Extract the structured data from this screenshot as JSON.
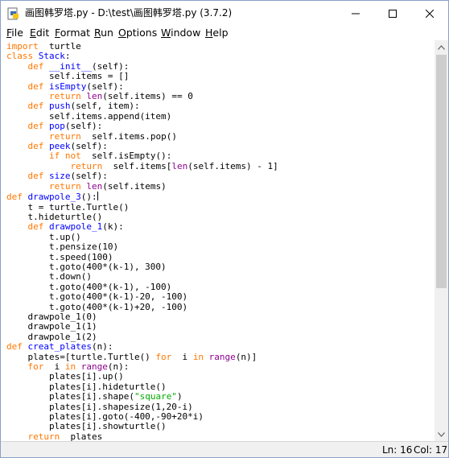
{
  "window": {
    "title": "画图韩罗塔.py - D:\\test\\画图韩罗塔.py (3.7.2)",
    "buttons": [
      "minimize",
      "maximize",
      "close"
    ]
  },
  "menu": [
    {
      "label": "File",
      "u": "F",
      "rest": "ile"
    },
    {
      "label": "Edit",
      "u": "E",
      "rest": "dit"
    },
    {
      "label": "Format",
      "u": "F",
      "rest": "ormat",
      "pre": ""
    },
    {
      "label": "Run",
      "u": "R",
      "rest": "un"
    },
    {
      "label": "Options",
      "u": "O",
      "rest": "ptions"
    },
    {
      "label": "Window",
      "u": "W",
      "rest": "indow"
    },
    {
      "label": "Help",
      "u": "H",
      "rest": "elp"
    }
  ],
  "code_lines": [
    [
      [
        "kw",
        "import"
      ],
      [
        "",
        "  turtle"
      ]
    ],
    [
      [
        "kw",
        "class"
      ],
      [
        "",
        ""
      ],
      [
        "df",
        " Stack"
      ],
      [
        "",
        ":"
      ]
    ],
    [
      [
        "",
        "    "
      ],
      [
        "kw",
        "def"
      ],
      [
        "df",
        " __init__"
      ],
      [
        "",
        "(self):"
      ]
    ],
    [
      [
        "",
        "        self.items = []"
      ]
    ],
    [
      [
        "",
        "    "
      ],
      [
        "kw",
        "def"
      ],
      [
        "df",
        " isEmpty"
      ],
      [
        "",
        "(self):"
      ]
    ],
    [
      [
        "",
        "        "
      ],
      [
        "kw",
        "return"
      ],
      [
        "bi",
        " len"
      ],
      [
        "",
        "(self.items) == 0"
      ]
    ],
    [
      [
        "",
        "    "
      ],
      [
        "kw",
        "def"
      ],
      [
        "df",
        " push"
      ],
      [
        "",
        "(self, item):"
      ]
    ],
    [
      [
        "",
        "        self.items.append(item)"
      ]
    ],
    [
      [
        "",
        "    "
      ],
      [
        "kw",
        "def"
      ],
      [
        "df",
        " pop"
      ],
      [
        "",
        "(self):"
      ]
    ],
    [
      [
        "",
        "        "
      ],
      [
        "kw",
        "return"
      ],
      [
        "",
        ""
      ],
      [
        "",
        "  self.items.pop()"
      ]
    ],
    [
      [
        "",
        "    "
      ],
      [
        "kw",
        "def"
      ],
      [
        "df",
        " peek"
      ],
      [
        "",
        "(self):"
      ]
    ],
    [
      [
        "",
        "        "
      ],
      [
        "kw",
        "if not"
      ],
      [
        "",
        "  self.isEmpty():"
      ]
    ],
    [
      [
        "",
        "            "
      ],
      [
        "kw",
        "return"
      ],
      [
        "",
        "  self.items["
      ],
      [
        "bi",
        "len"
      ],
      [
        "",
        "(self.items) - 1]"
      ]
    ],
    [
      [
        "",
        "    "
      ],
      [
        "kw",
        "def"
      ],
      [
        "df",
        " size"
      ],
      [
        "",
        "(self):"
      ]
    ],
    [
      [
        "",
        "        "
      ],
      [
        "kw",
        "return"
      ],
      [
        "bi",
        " len"
      ],
      [
        "",
        "(self.items)"
      ]
    ],
    [
      [
        "kw",
        "def"
      ],
      [
        "df",
        " drawpole_3"
      ],
      [
        "",
        "():"
      ],
      [
        "caret",
        ""
      ]
    ],
    [
      [
        "",
        "    t = turtle.Turtle()"
      ]
    ],
    [
      [
        "",
        "    t.hideturtle()"
      ]
    ],
    [
      [
        "",
        "    "
      ],
      [
        "kw",
        "def"
      ],
      [
        "df",
        " drawpole_1"
      ],
      [
        "",
        "(k):"
      ]
    ],
    [
      [
        "",
        "        t.up()"
      ]
    ],
    [
      [
        "",
        "        t.pensize(10)"
      ]
    ],
    [
      [
        "",
        "        t.speed(100)"
      ]
    ],
    [
      [
        "",
        "        t.goto(400*(k-1), 300)"
      ]
    ],
    [
      [
        "",
        "        t.down()"
      ]
    ],
    [
      [
        "",
        "        t.goto(400*(k-1), -100)"
      ]
    ],
    [
      [
        "",
        "        t.goto(400*(k-1)-20, -100)"
      ]
    ],
    [
      [
        "",
        "        t.goto(400*(k-1)+20, -100)"
      ]
    ],
    [
      [
        "",
        "    drawpole_1(0)"
      ]
    ],
    [
      [
        "",
        "    drawpole_1(1)"
      ]
    ],
    [
      [
        "",
        "    drawpole_1(2)"
      ]
    ],
    [
      [
        "kw",
        "def"
      ],
      [
        "df",
        " creat_plates"
      ],
      [
        "",
        "(n):"
      ]
    ],
    [
      [
        "",
        "    plates=[turtle.Turtle() "
      ],
      [
        "kw",
        "for"
      ],
      [
        "",
        ""
      ],
      [
        "",
        "  i "
      ],
      [
        "kw",
        "in"
      ],
      [
        "bi",
        " range"
      ],
      [
        "",
        "(n)]"
      ]
    ],
    [
      [
        "",
        "    "
      ],
      [
        "kw",
        "for"
      ],
      [
        "",
        "  i "
      ],
      [
        "kw",
        "in"
      ],
      [
        "bi",
        " range"
      ],
      [
        "",
        "(n):"
      ]
    ],
    [
      [
        "",
        "        plates[i].up()"
      ]
    ],
    [
      [
        "",
        "        plates[i].hideturtle()"
      ]
    ],
    [
      [
        "",
        "        plates[i].shape("
      ],
      [
        "st",
        "\"square\""
      ],
      [
        "",
        ")"
      ]
    ],
    [
      [
        "",
        "        plates[i].shapesize(1,20-i)"
      ]
    ],
    [
      [
        "",
        "        plates[i].goto(-400,-90+20*i)"
      ]
    ],
    [
      [
        "",
        "        plates[i].showturtle()"
      ]
    ],
    [
      [
        "",
        "    "
      ],
      [
        "kw",
        "return"
      ],
      [
        "",
        "  plates"
      ]
    ]
  ],
  "status": {
    "line": "Ln: 16",
    "col": "Col: 17"
  }
}
